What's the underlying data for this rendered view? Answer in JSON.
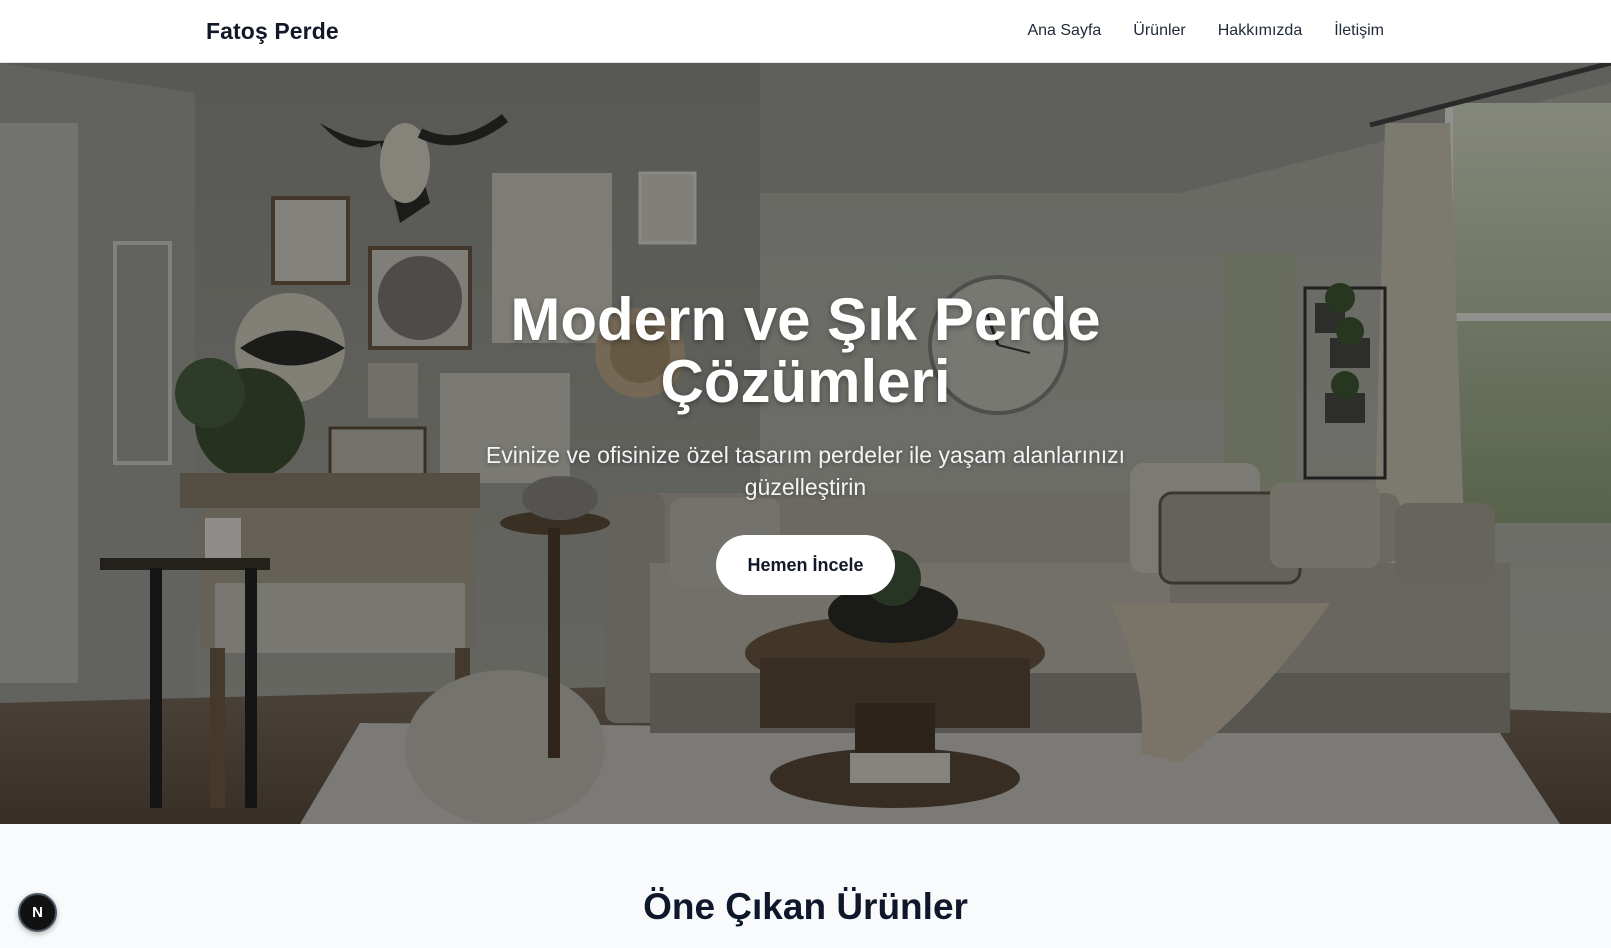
{
  "brand": {
    "name": "Fatoş Perde"
  },
  "nav": {
    "items": [
      {
        "label": "Ana Sayfa"
      },
      {
        "label": "Ürünler"
      },
      {
        "label": "Hakkımızda"
      },
      {
        "label": "İletişim"
      }
    ]
  },
  "hero": {
    "title": "Modern ve Şık Perde Çözümleri",
    "subtitle": "Evinize ve ofisinize özel tasarım perdeler ile yaşam alanlarınızı güzelleştirin",
    "cta_label": "Hemen İncele",
    "background_icon": "living-room-photo"
  },
  "featured": {
    "title": "Öne Çıkan Ürünler"
  },
  "dev_badge": {
    "label": "N",
    "icon": "nextjs-icon"
  },
  "colors": {
    "nav_bg": "#ffffff",
    "hero_overlay": "#000000",
    "cta_bg": "#ffffff",
    "section_bg": "#f8fafc",
    "text_dark": "#0f172a"
  }
}
